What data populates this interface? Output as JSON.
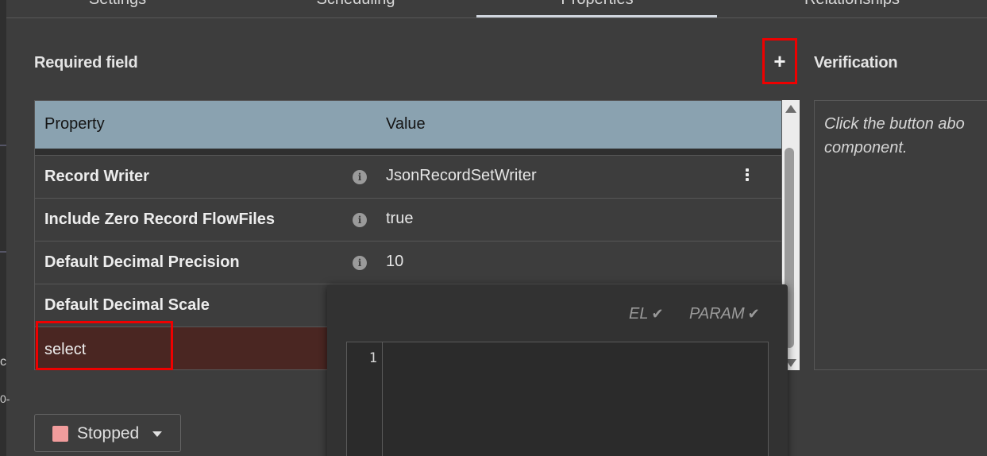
{
  "tabs": [
    {
      "label": "Settings"
    },
    {
      "label": "Scheduling"
    },
    {
      "label": "Properties",
      "active": true
    },
    {
      "label": "Relationships"
    }
  ],
  "left_edge": {
    "char1": "c",
    "char2": "0-"
  },
  "properties": {
    "section_title": "Required field",
    "add_label": "+",
    "table": {
      "headers": {
        "property": "Property",
        "value": "Value"
      },
      "rows": [
        {
          "name": "Record Writer",
          "value": "JsonRecordSetWriter",
          "has_info": true,
          "has_menu": true
        },
        {
          "name": "Include Zero Record FlowFiles",
          "value": "true",
          "has_info": true
        },
        {
          "name": "Default Decimal Precision",
          "value": "10",
          "has_info": true
        },
        {
          "name": "Default Decimal Scale",
          "value": "",
          "has_info": false
        },
        {
          "name": "select",
          "value": "",
          "has_info": false,
          "selected": true
        }
      ]
    }
  },
  "verification": {
    "title": "Verification",
    "text_line1": "Click the button abo",
    "text_line2": "component."
  },
  "editor": {
    "el_label": "EL",
    "param_label": "PARAM",
    "line_number": "1"
  },
  "status": {
    "label": "Stopped",
    "color": "#f19c9c"
  },
  "colors": {
    "header": "#8aa2b0",
    "selected_row": "#4a2622",
    "highlight": "#e00000"
  }
}
